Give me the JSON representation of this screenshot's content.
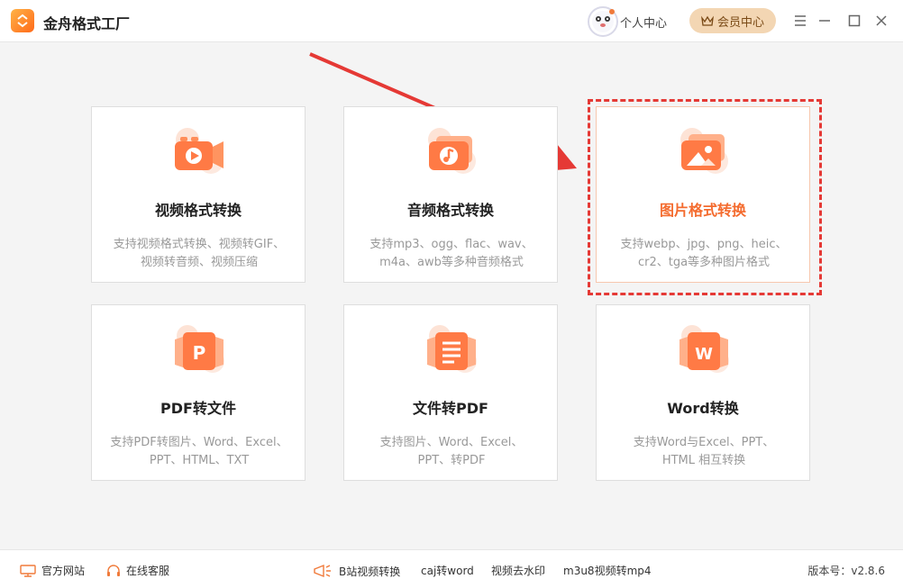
{
  "app": {
    "title": "金舟格式工厂"
  },
  "header": {
    "user_center": "个人中心",
    "member_center": "会员中心"
  },
  "cards": [
    {
      "title": "视频格式转换",
      "desc1": "支持视频格式转换、视频转GIF、",
      "desc2": "视频转音频、视频压缩"
    },
    {
      "title": "音频格式转换",
      "desc1": "支持mp3、ogg、flac、wav、",
      "desc2": "m4a、awb等多种音频格式"
    },
    {
      "title": "图片格式转换",
      "desc1": "支持webp、jpg、png、heic、",
      "desc2": "cr2、tga等多种图片格式"
    },
    {
      "title": "PDF转文件",
      "desc1": "支持PDF转图片、Word、Excel、",
      "desc2": "PPT、HTML、TXT"
    },
    {
      "title": "文件转PDF",
      "desc1": "支持图片、Word、Excel、",
      "desc2": "PPT、转PDF"
    },
    {
      "title": "Word转换",
      "desc1": "支持Word与Excel、PPT、",
      "desc2": "HTML 相互转换"
    }
  ],
  "icon_letters": {
    "pdf": "P",
    "word": "W"
  },
  "footer": {
    "official_site": "官方网站",
    "online_service": "在线客服",
    "links": [
      "B站视频转换",
      "caj转word",
      "视频去水印",
      "m3u8视频转mp4"
    ],
    "version": "版本号：v2.8.6"
  },
  "colors": {
    "accent": "#f46b2e",
    "highlight_border": "#e53935",
    "member_bg": "#f3d6b3"
  }
}
